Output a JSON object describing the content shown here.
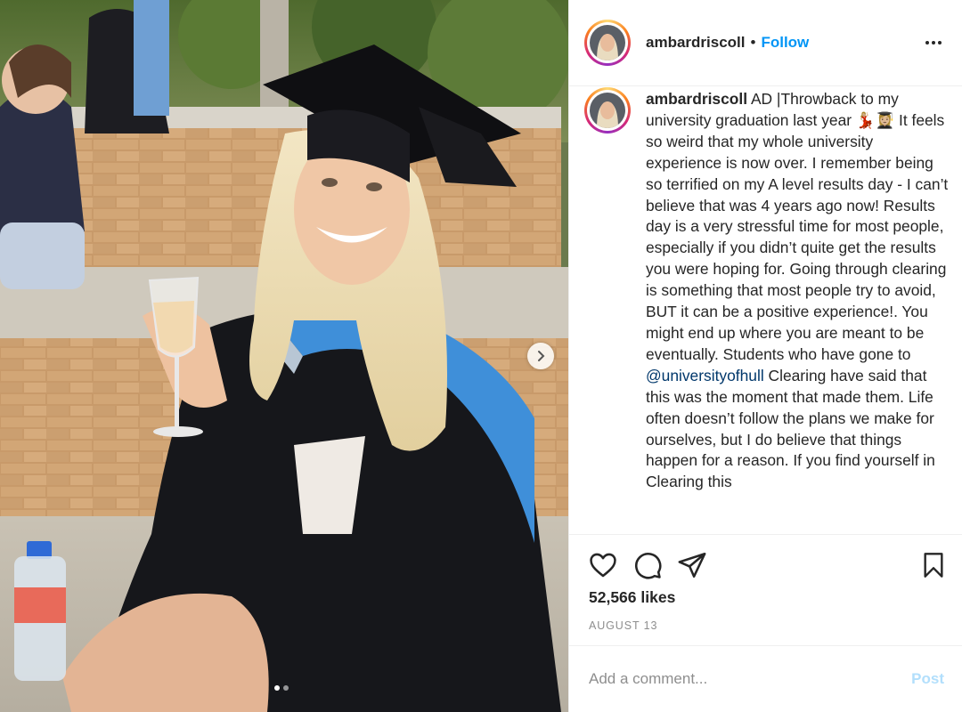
{
  "post": {
    "author": "ambardriscoll",
    "separator": "•",
    "follow_label": "Follow",
    "caption_username": "ambardriscoll",
    "caption_part1": "AD |Throwback to my university graduation last year 💃🏼👩🏼‍🎓 It feels so weird that my whole university experience is now over. I remember being so terrified on my A level results day - I can’t believe that was 4 years ago now! Results day is a very stressful time for most people, especially if you didn’t quite get the results you were hoping for. Going through clearing is something that most people try to avoid, BUT it can be a positive experience!. You might end up where you are meant to be eventually. Students who have gone to ",
    "mention": "@universityofhull",
    "caption_part2": " Clearing have said that this was the moment that made them. Life often doesn’t follow the plans we make for ourselves, but I do believe that things happen for a reason. If you find yourself in Clearing this",
    "likes": "52,566 likes",
    "date": "AUGUST 13",
    "comment_placeholder": "Add a comment...",
    "post_label": "Post"
  },
  "carousel": {
    "slide_count": 2,
    "active_index": 0
  },
  "icons": {
    "like": "heart-icon",
    "comment": "comment-icon",
    "share": "paper-plane-icon",
    "save": "bookmark-icon",
    "more": "more-options-icon",
    "next": "chevron-right-icon"
  },
  "colors": {
    "follow": "#0095f6",
    "post_disabled": "#b2dffc",
    "mention": "#00376b",
    "muted": "#8e8e8e",
    "text": "#262626"
  }
}
